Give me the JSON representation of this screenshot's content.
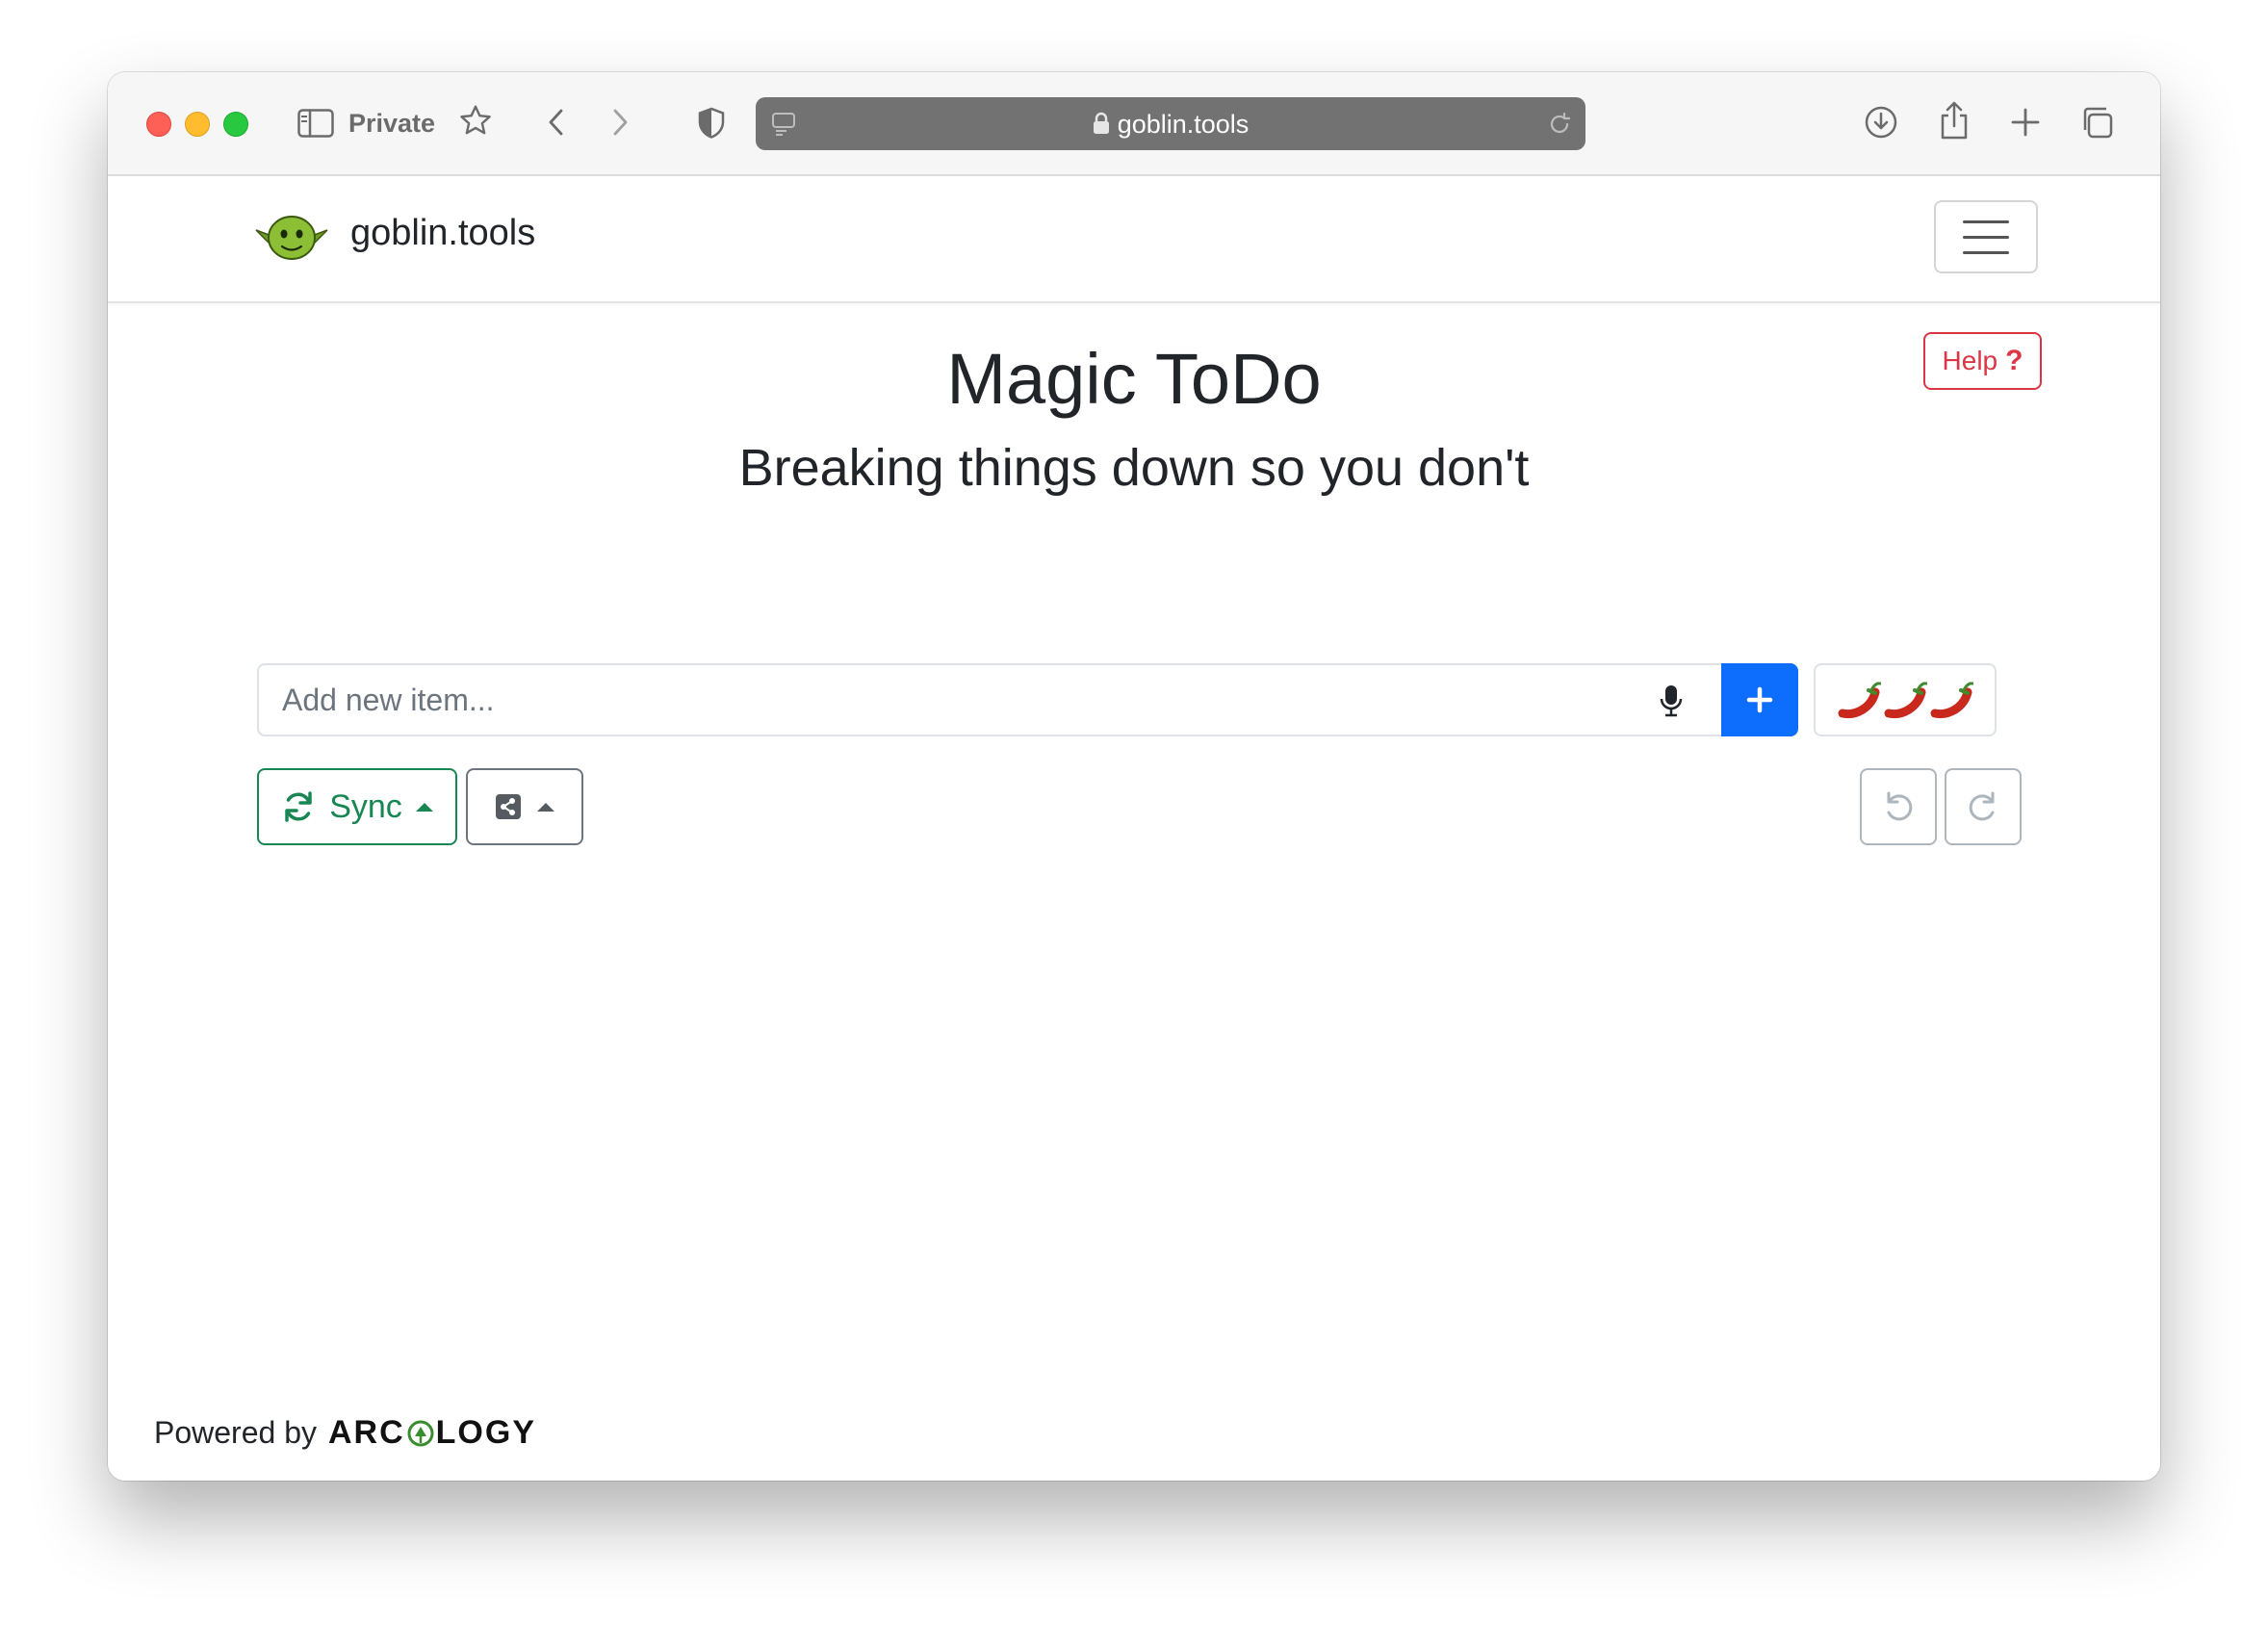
{
  "browser": {
    "private_label": "Private",
    "url": "goblin.tools"
  },
  "navbar": {
    "brand": "goblin.tools",
    "logo": "goblin-face-icon",
    "menu_icon": "hamburger-icon"
  },
  "main": {
    "title": "Magic ToDo",
    "subtitle": "Breaking things down so you don't",
    "help_label": "Help",
    "help_icon": "question-icon",
    "input_placeholder": "Add new item...",
    "spiciness": [
      "🌶️",
      "🌶️",
      "🌶️"
    ],
    "sync_label": "Sync"
  },
  "footer": {
    "powered_by": "Powered by",
    "company_pre": "ARC",
    "company_post": "LOGY"
  },
  "colors": {
    "primary": "#0d6efd",
    "success": "#198754",
    "danger": "#dc3545",
    "secondary": "#6c757d"
  }
}
